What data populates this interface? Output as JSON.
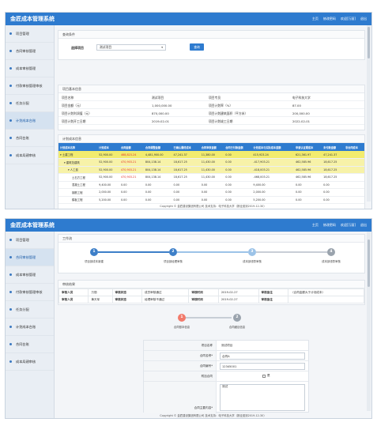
{
  "app": {
    "title": "金匠成本管理系统",
    "nav": [
      "主页",
      "修改密码",
      "欢迎[万丽]",
      "退出"
    ]
  },
  "sidebar": {
    "items": [
      {
        "label": "项目管理"
      },
      {
        "label": "合同审核管理"
      },
      {
        "label": "成本审核管理"
      },
      {
        "label": "付款审核管理审核"
      },
      {
        "label": "任务分配"
      },
      {
        "label": "计划成本台账"
      },
      {
        "label": "合同台账"
      },
      {
        "label": "成本局建审核"
      }
    ]
  },
  "screen1": {
    "query_panel": {
      "title": "查询条件",
      "select_label": "选择项目",
      "select_value": "测试项目",
      "button_label": "查询"
    },
    "basic_panel": {
      "title": "项目基本信息",
      "rows": [
        {
          "k1": "项目名称",
          "v1": "测试项目",
          "k2": "项目专员",
          "v2": "电子科技大学"
        },
        {
          "k1": "项目金额（元）",
          "v1": "1,000,000.00",
          "k2": "项目计划率（%）",
          "v2": "87.00"
        },
        {
          "k1": "项目计划利润值（元）",
          "v1": "870,000.00",
          "k2": "项目计划建筑面积（平方米）",
          "v2": "200,000.00"
        },
        {
          "k1": "项目计划开工日期",
          "v1": "2019-02-01",
          "k2": "项目计划竣工日期",
          "v2": "2022-02-01"
        }
      ]
    },
    "cost_panel": {
      "title": "计划成本信息",
      "headers": [
        "计划成本名称",
        "计划成本",
        "合同金额",
        "合同调整金额",
        "已确认最终成本",
        "合同审核金额",
        "合同已付款金额",
        "计划成本与实际成本差额",
        "申请认证期成本",
        "未付款金额",
        "非合同成本"
      ],
      "rows": [
        {
          "cells": [
            "▾ 土建工程",
            "52,900.00",
            "468,823.24",
            "4,481,900.00",
            "47,241.37",
            "11,380.00",
            "0.00",
            "415,923.24",
            "621,361.97",
            "47,241.37",
            ""
          ],
          "style": "hl1",
          "red": [
            2
          ]
        },
        {
          "cells": [
            "▾ 建筑范建筑",
            "52,900.00",
            "470,903.21",
            "804,138.14",
            "18,617.25",
            "11,430.00",
            "0.00",
            "-417,903.21",
            "462,585.96",
            "18,617.25",
            ""
          ],
          "style": "hl2",
          "red": [
            2
          ],
          "indent": 1
        },
        {
          "cells": [
            "▾ 人工费",
            "52,900.00",
            "470,903.21",
            "804,138.14",
            "18,617.25",
            "11,430.00",
            "0.00",
            "-418,003.21",
            "462,585.96",
            "18,617.25",
            ""
          ],
          "style": "hl2",
          "red": [
            2
          ],
          "indent": 2
        },
        {
          "cells": [
            "土石方工程",
            "52,900.00",
            "470,903.21",
            "804,138.14",
            "18,617.25",
            "11,430.00",
            "0.00",
            "-468,003.21",
            "462,585.96",
            "18,617.25",
            ""
          ],
          "style": "",
          "red": [
            2
          ],
          "indent": 3
        },
        {
          "cells": [
            "混凝土工程",
            "9,400.00",
            "0.00",
            "0.00",
            "0.00",
            "0.00",
            "0.00",
            "9,400.00",
            "0.00",
            "0.00",
            ""
          ],
          "style": "",
          "red": [],
          "indent": 3
        },
        {
          "cells": [
            "钢筋工程",
            "2,000.00",
            "0.00",
            "0.00",
            "0.00",
            "0.00",
            "0.00",
            "2,000.00",
            "0.00",
            "0.00",
            ""
          ],
          "style": "",
          "red": [],
          "indent": 3
        },
        {
          "cells": [
            "模板工程",
            "5,200.00",
            "0.00",
            "0.00",
            "0.00",
            "0.00",
            "0.00",
            "5,200.00",
            "0.00",
            "0.00",
            ""
          ],
          "style": "",
          "red": [],
          "indent": 3
        }
      ]
    },
    "copyright": "Copyright © 金匠建设集团有限公司 技术支持：电子科技大学（报征费到2019-12-30）"
  },
  "screen2": {
    "workflow_panel": {
      "title": "工作流",
      "steps": [
        {
          "num": "1",
          "label": "项目部成本新建"
        },
        {
          "num": "2",
          "label": "项目部经理审核"
        },
        {
          "num": "3",
          "label": "成本部领导审核"
        },
        {
          "num": "4",
          "label": "成本部领导审核"
        }
      ]
    },
    "audit_panel": {
      "title": "审核结果",
      "rows": [
        [
          "审核人员",
          "万丽",
          "审核状态",
          "成员审核通过",
          "审核时间",
          "2019-02-27",
          "审核备注",
          "（合同金额大于计划成本）"
        ],
        [
          "审核人员",
          "黄天军",
          "审核状态",
          "经理审核不通过",
          "审核时间",
          "2019-02-27",
          "审核备注",
          ""
        ]
      ],
      "substeps": [
        {
          "num": "1",
          "label": "合同基本信息"
        },
        {
          "num": "2",
          "label": "合同细目信息"
        }
      ]
    },
    "form": {
      "rows": [
        {
          "label": "项目名称",
          "value": "测试项目"
        },
        {
          "label": "合同名称*",
          "value": "合同A"
        },
        {
          "label": "合同编号*",
          "value": "12345001"
        },
        {
          "label": "附加合同",
          "value": "是"
        },
        {
          "label": "合同主要内容*",
          "value": "测试"
        }
      ]
    },
    "copyright": "Copyright © 金匠建设集团有限公司 技术支持：电子科技大学（报征费到2019-12-30）"
  }
}
